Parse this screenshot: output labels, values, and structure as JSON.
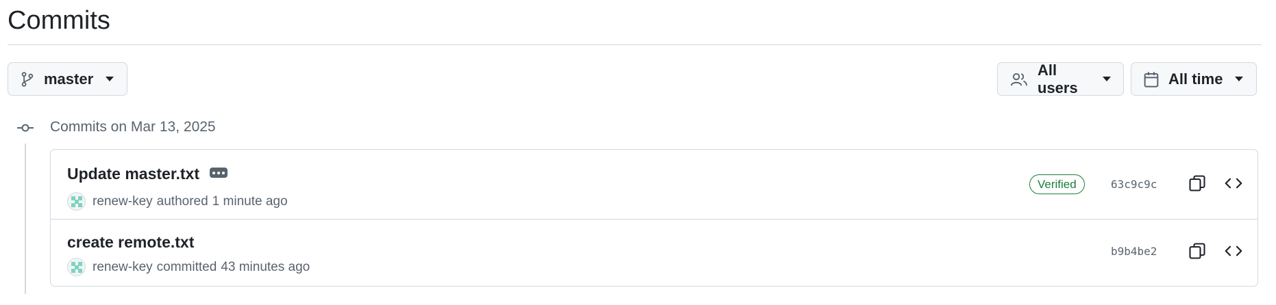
{
  "page": {
    "title": "Commits"
  },
  "toolbar": {
    "branch_label": "master",
    "users_label": "All users",
    "time_label": "All time"
  },
  "commit_group": {
    "heading": "Commits on Mar 13, 2025",
    "commits": [
      {
        "message": "Update master.txt",
        "author": "renew-key",
        "action": "authored",
        "time": "1 minute ago",
        "badge": "Verified",
        "sha": "63c9c9c"
      },
      {
        "message": "create remote.txt",
        "author": "renew-key",
        "action": "committed",
        "time": "43 minutes ago",
        "sha": "b9b4be2"
      }
    ]
  },
  "icons": {
    "branch": "git-branch-icon",
    "users": "people-icon",
    "calendar": "calendar-icon",
    "commit_node": "git-commit-icon",
    "copy": "copy-icon",
    "browse": "code-icon",
    "ellipsis": "ellipsis-icon"
  },
  "colors": {
    "text": "#1f2328",
    "muted": "#59636e",
    "border": "#d1d9e0",
    "verified": "#1a7f37",
    "button_bg": "#f6f8fa"
  }
}
